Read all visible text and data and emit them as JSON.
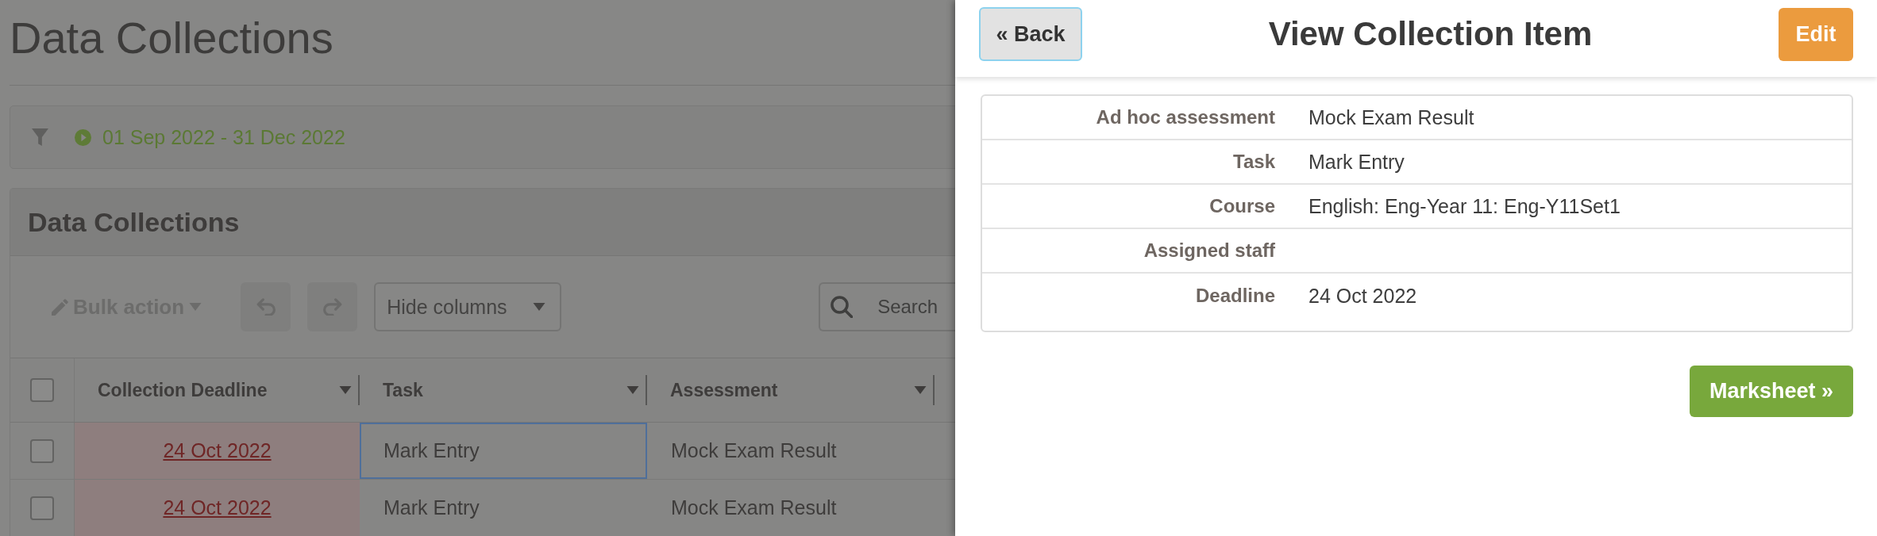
{
  "page": {
    "title": "Data Collections"
  },
  "filter": {
    "date_range": "01 Sep 2022 - 31 Dec 2022"
  },
  "panel": {
    "title": "Data Collections",
    "toolbar": {
      "bulk_action": {
        "label": "Bulk action",
        "disabled": true
      },
      "undo": {
        "disabled": true
      },
      "redo": {
        "disabled": true
      },
      "hide_columns": "Hide columns",
      "search": {
        "placeholder": "Search"
      }
    },
    "table": {
      "select_all": {
        "checked": false
      },
      "columns": [
        "Collection Deadline",
        "Task",
        "Assessment"
      ],
      "rows": [
        {
          "checked": false,
          "deadline": "24 Oct 2022",
          "overdue": true,
          "task": "Mark Entry",
          "task_focused": true,
          "assessment": "Mock Exam Result"
        },
        {
          "checked": false,
          "deadline": "24 Oct 2022",
          "overdue": true,
          "task": "Mark Entry",
          "task_focused": false,
          "assessment": "Mock Exam Result"
        }
      ]
    }
  },
  "detail_panel": {
    "back": "« Back",
    "title": "View Collection Item",
    "edit": "Edit",
    "fields": [
      {
        "label": "Ad hoc assessment",
        "value": "Mock Exam Result"
      },
      {
        "label": "Task",
        "value": "Mark Entry"
      },
      {
        "label": "Course",
        "value": "English: Eng-Year 11: Eng-Y11Set1"
      },
      {
        "label": "Assigned staff"
      },
      {
        "label": "Deadline",
        "value": "24 Oct 2022"
      }
    ],
    "marksheet": "Marksheet »"
  }
}
